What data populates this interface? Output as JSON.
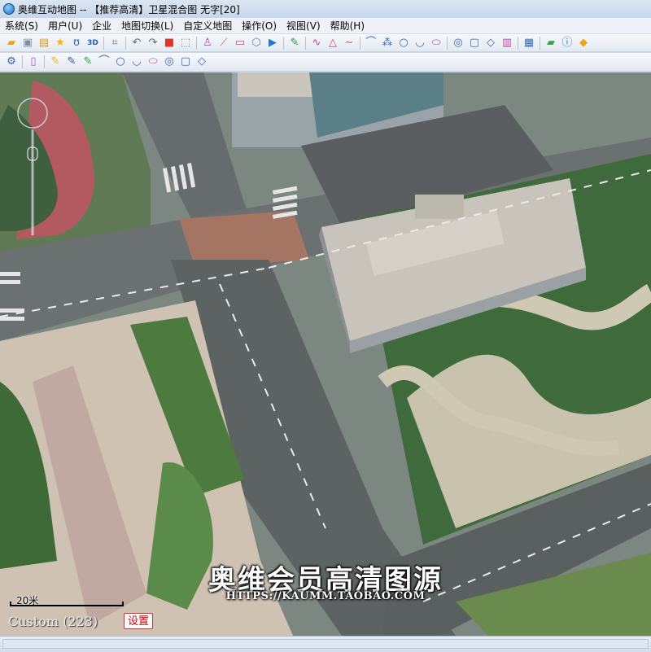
{
  "window": {
    "title": "奥维互动地图 -- 【推荐高清】卫星混合图 无字[20]",
    "app_icon": "app-globe-icon"
  },
  "menubar": {
    "items": [
      {
        "label": "系统(S)"
      },
      {
        "label": "用户(U)"
      },
      {
        "label": "企业"
      },
      {
        "label": "地图切换(L)"
      },
      {
        "label": "自定义地图"
      },
      {
        "label": "操作(O)"
      },
      {
        "label": "视图(V)"
      },
      {
        "label": "帮助(H)"
      }
    ]
  },
  "toolbar_main": {
    "icons": [
      {
        "name": "open-folder-icon",
        "glyph": "▰",
        "color": "#e8a317"
      },
      {
        "name": "save-icon",
        "glyph": "▣",
        "color": "#7a8fa6"
      },
      {
        "name": "favorites-folder-icon",
        "glyph": "▤",
        "color": "#d99a1d"
      },
      {
        "name": "star-icon",
        "glyph": "★",
        "color": "#f5b800"
      },
      {
        "name": "track-icon",
        "glyph": "ʊ",
        "color": "#2b66c9"
      },
      {
        "name": "3d-icon",
        "glyph": "3D",
        "color": "#1d5fb8"
      },
      {
        "name": "sep"
      },
      {
        "name": "crop-icon",
        "glyph": "⌗",
        "color": "#6f7f92"
      },
      {
        "name": "sep"
      },
      {
        "name": "undo-icon",
        "glyph": "↶",
        "color": "#5c6d80"
      },
      {
        "name": "redo-icon",
        "glyph": "↷",
        "color": "#5c6d80"
      },
      {
        "name": "delete-icon",
        "glyph": "■",
        "color": "#e0342b"
      },
      {
        "name": "select-icon",
        "glyph": "⬚",
        "color": "#7b8ea3"
      },
      {
        "name": "sep"
      },
      {
        "name": "measure-icon",
        "glyph": "♙",
        "color": "#a24cc4"
      },
      {
        "name": "ruler-icon",
        "glyph": "⟋",
        "color": "#c0508b"
      },
      {
        "name": "area-icon",
        "glyph": "▭",
        "color": "#c04a8d"
      },
      {
        "name": "polygon-icon",
        "glyph": "⬡",
        "color": "#5a7dbb"
      },
      {
        "name": "camera-icon",
        "glyph": "▶",
        "color": "#2574d6"
      },
      {
        "name": "sep"
      },
      {
        "name": "pin-icon",
        "glyph": "✎",
        "color": "#2d9a3d"
      },
      {
        "name": "sep"
      },
      {
        "name": "line-icon",
        "glyph": "∿",
        "color": "#d13f8a"
      },
      {
        "name": "triangle-icon",
        "glyph": "△",
        "color": "#d13f8a"
      },
      {
        "name": "curve-icon",
        "glyph": "∼",
        "color": "#d13f8a"
      },
      {
        "name": "sep"
      },
      {
        "name": "arc-icon",
        "glyph": "⌒",
        "color": "#3466b8"
      },
      {
        "name": "points-icon",
        "glyph": "⁂",
        "color": "#3466b8"
      },
      {
        "name": "circle-icon",
        "glyph": "○",
        "color": "#3466b8"
      },
      {
        "name": "arc-open-icon",
        "glyph": "◡",
        "color": "#3466b8"
      },
      {
        "name": "ellipse-icon",
        "glyph": "⬭",
        "color": "#b03fa6"
      },
      {
        "name": "sep"
      },
      {
        "name": "ring-icon",
        "glyph": "◎",
        "color": "#3466b8"
      },
      {
        "name": "square-ring-icon",
        "glyph": "▢",
        "color": "#3466b8"
      },
      {
        "name": "layer-icon",
        "glyph": "◇",
        "color": "#3466b8"
      },
      {
        "name": "bars-icon",
        "glyph": "▥",
        "color": "#c04aa8"
      },
      {
        "name": "sep"
      },
      {
        "name": "grid-icon",
        "glyph": "▦",
        "color": "#3c6fb8"
      },
      {
        "name": "sep"
      },
      {
        "name": "chat-icon",
        "glyph": "▰",
        "color": "#3aa34a"
      },
      {
        "name": "info-icon",
        "glyph": "ⓘ",
        "color": "#1f6fd6"
      },
      {
        "name": "diamond-icon",
        "glyph": "◆",
        "color": "#f0a21a"
      }
    ]
  },
  "toolbar_secondary": {
    "icons": [
      {
        "name": "settings-gear-icon",
        "glyph": "⚙",
        "color": "#3a63a8"
      },
      {
        "name": "sep"
      },
      {
        "name": "document-icon",
        "glyph": "▯",
        "color": "#9b5cc9"
      },
      {
        "name": "sep"
      },
      {
        "name": "pushpin-yellow-icon",
        "glyph": "✎",
        "color": "#e0b81b"
      },
      {
        "name": "pushpin-blue-icon",
        "glyph": "✎",
        "color": "#2c56b4"
      },
      {
        "name": "pushpin-green-icon",
        "glyph": "✎",
        "color": "#2ea33d"
      },
      {
        "name": "arc-icon",
        "glyph": "⌒",
        "color": "#3466b8"
      },
      {
        "name": "circle-icon",
        "glyph": "○",
        "color": "#3466b8"
      },
      {
        "name": "arc-open-icon",
        "glyph": "◡",
        "color": "#3466b8"
      },
      {
        "name": "ellipse-icon",
        "glyph": "⬭",
        "color": "#b03fa6"
      },
      {
        "name": "ring-icon",
        "glyph": "◎",
        "color": "#3466b8"
      },
      {
        "name": "square-ring-icon",
        "glyph": "▢",
        "color": "#3466b8"
      },
      {
        "name": "layer-icon",
        "glyph": "◇",
        "color": "#3466b8"
      }
    ]
  },
  "map": {
    "watermark_main": "奥维会员高清图源",
    "watermark_sub": "HTTPS://KAUMM.TAOBAO.COM",
    "scale_label": "20米",
    "custom_label": "Custom (223)",
    "settings_button": "设置",
    "zoom_control_icon": "zoom-slider-icon"
  },
  "colors": {
    "titlebar": "#c7d6ea",
    "toolbar": "#e4eaf2",
    "settings_border": "#cc3333",
    "watermark": "#ffffff"
  }
}
